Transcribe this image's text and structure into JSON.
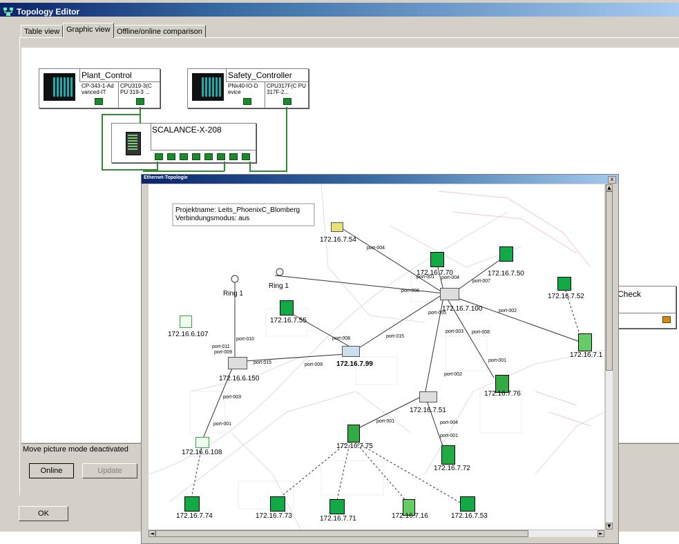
{
  "window": {
    "title": "Topology Editor"
  },
  "tabs": [
    {
      "label": "Table view"
    },
    {
      "label": "Graphic view"
    },
    {
      "label": "Offline/online comparison"
    }
  ],
  "devices": {
    "plant_control": {
      "name": "Plant_Control",
      "sub1": "CP-343-1-Ad vanced-IT",
      "sub2": "CPU319-3(C PU 319-3 ..."
    },
    "safety_controller": {
      "name": "Safety_Controller",
      "sub1": "PNx40-IO-D evice",
      "sub2": "CPU317F(C PU 317F-2..."
    },
    "scalance": {
      "name": "SCALANCE-X-208"
    },
    "partial_device": {
      "name": "-Check"
    }
  },
  "status": {
    "text": "Move picture mode deactivated"
  },
  "buttons": {
    "online": "Online",
    "update": "Update",
    "ok": "OK"
  },
  "ethernet_window": {
    "title": "Ethernet-Topologie",
    "close": "x",
    "project_line1": "Projektname: Leits_PhoenixC_Blomberg",
    "project_line2": "Verbindungsmodus: aus",
    "rings": [
      "Ring 1",
      "Ring 1"
    ],
    "nodes": [
      "172.16.7.54",
      "172.16.7.70",
      "172.16.7.50",
      "172.16.7.52",
      "172.16.7.55",
      "172.16.6.107",
      "172.16.7.100",
      "172.16.7.99",
      "172.16.6.150",
      "172.16.7.1",
      "172.16.7.76",
      "172.16.7.51",
      "172.16.7.75",
      "172.16.6.108",
      "172.16.7.72",
      "172.16.7.74",
      "172.16.7.73",
      "172.16.7.71",
      "172.16.7.16",
      "172.16.7.53"
    ],
    "ports": [
      "port-004",
      "port-001",
      "port-004",
      "port-007",
      "port-006",
      "port-005",
      "port-002",
      "port-010",
      "port-011",
      "port-009",
      "port-008",
      "port-015",
      "port-003",
      "port-008",
      "port-001",
      "port-015",
      "port-009",
      "port-003",
      "port-001",
      "port-002",
      "port-001",
      "port-004",
      "port-001"
    ]
  },
  "colors": {
    "titlebar": "#0a246a",
    "port_green": "#1a8a2a",
    "wire_green": "#2e8b2e",
    "status_orange": "#d08a1a"
  }
}
